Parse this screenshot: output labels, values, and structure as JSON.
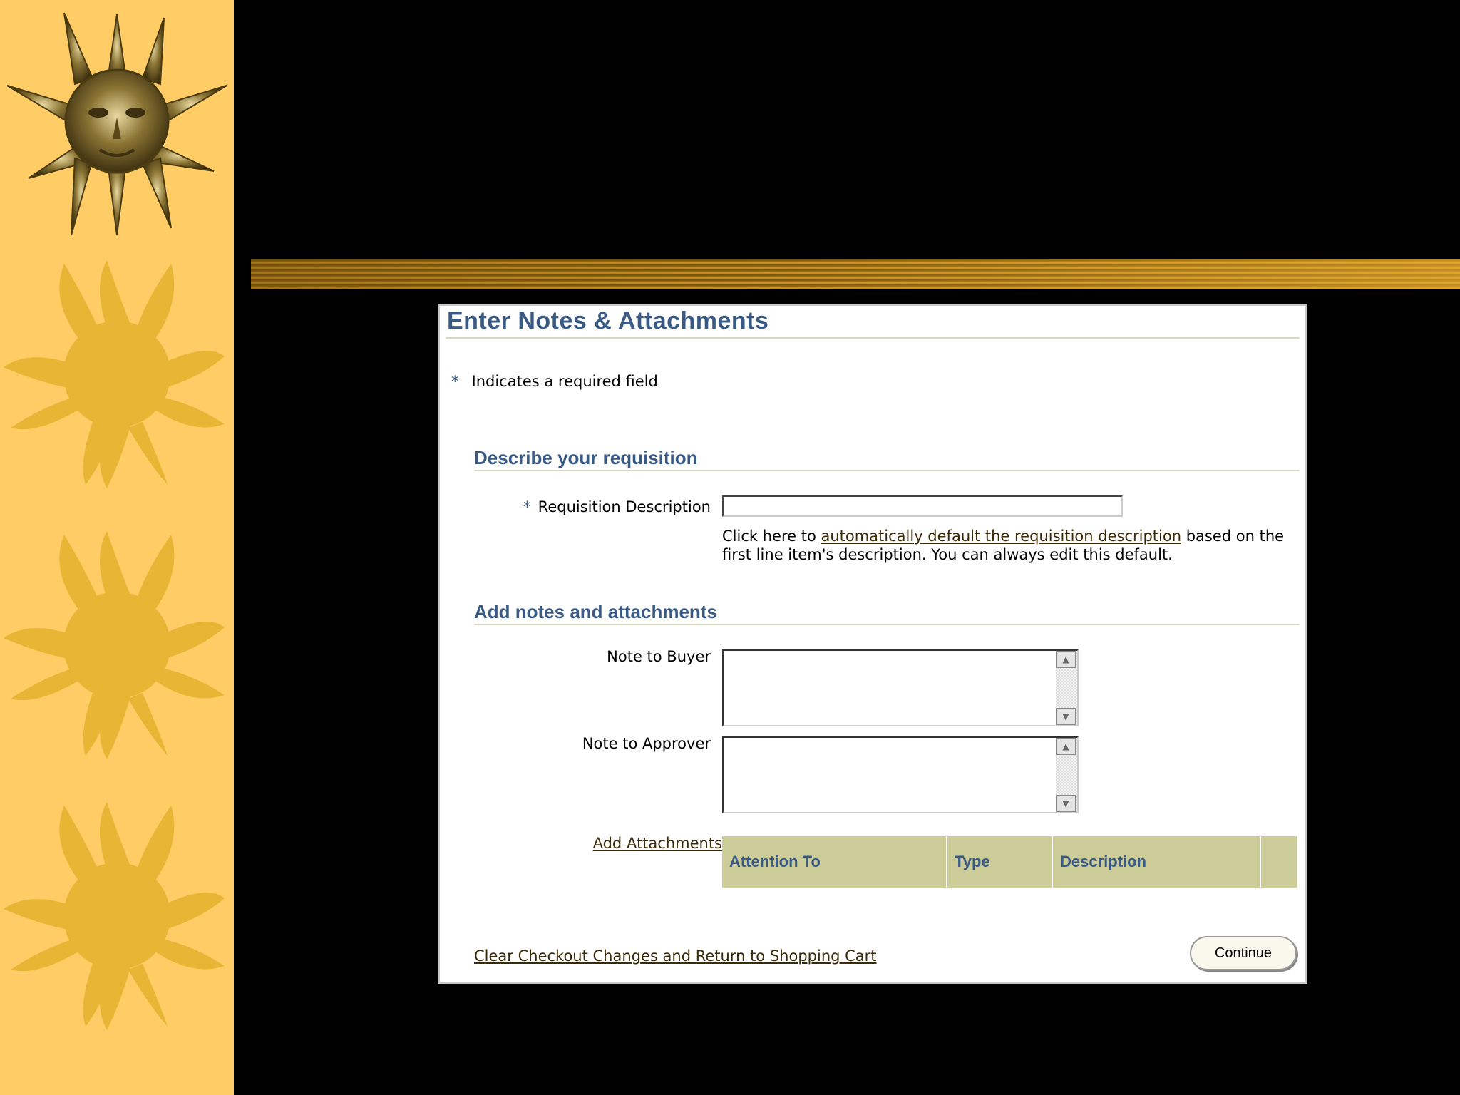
{
  "dialog": {
    "title": "Enter Notes & Attachments",
    "required_note": "Indicates a required field",
    "required_marker": "*"
  },
  "section_describe": {
    "title": "Describe your requisition",
    "description_label": "Requisition Description",
    "description_value": "",
    "hint_before": "Click here to ",
    "hint_link": "automatically default the requisition description",
    "hint_after": " based on the first line item's description. You can always edit this default."
  },
  "section_notes": {
    "title": "Add notes and attachments",
    "note_buyer_label": "Note to Buyer",
    "note_approver_label": "Note to Approver",
    "add_attachments_link": "Add Attachments",
    "columns": [
      "Attention To",
      "Type",
      "Description",
      ""
    ]
  },
  "footer": {
    "clear_link": "Clear Checkout Changes and Return to Shopping Cart",
    "continue_label": "Continue"
  },
  "theme": {
    "sidebar": "#ffcc66",
    "sun_decor": "#e8b535",
    "heading": "#3a5a86",
    "table_header": "#cccc99"
  }
}
